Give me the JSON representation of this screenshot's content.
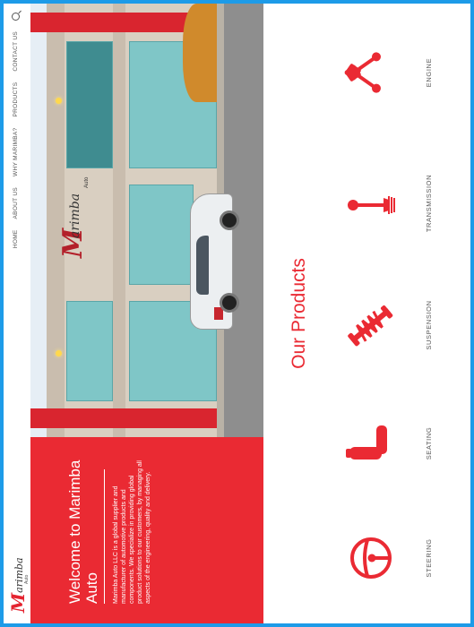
{
  "brand": {
    "logo_initial": "M",
    "logo_rest": "arimba",
    "logo_sub": "Auto"
  },
  "nav": {
    "items": [
      "HOME",
      "ABOUT US",
      "WHY MARIMBA?",
      "PRODUCTS",
      "CONTACT US"
    ],
    "search_icon": "search-icon"
  },
  "hero": {
    "heading": "Welcome to Marimba Auto",
    "body": "Marimba Auto LLC is a global supplier and manufacturer of automotive products and components. We specialize in providing global product solutions to our customers, by managing all aspects of the engineering, quality and delivery.",
    "building_sign": {
      "initial": "M",
      "rest": "arimba",
      "sub": "Auto"
    }
  },
  "products": {
    "title": "Our Products",
    "items": [
      {
        "label": "STEERING",
        "icon": "steering-wheel-icon"
      },
      {
        "label": "SEATING",
        "icon": "car-seat-icon"
      },
      {
        "label": "SUSPENSION",
        "icon": "shock-absorber-icon"
      },
      {
        "label": "TRANSMISSION",
        "icon": "gear-shift-icon"
      },
      {
        "label": "ENGINE",
        "icon": "engine-pistons-icon"
      }
    ]
  },
  "colors": {
    "accent": "#ea2a33",
    "frame": "#1d9be8"
  }
}
